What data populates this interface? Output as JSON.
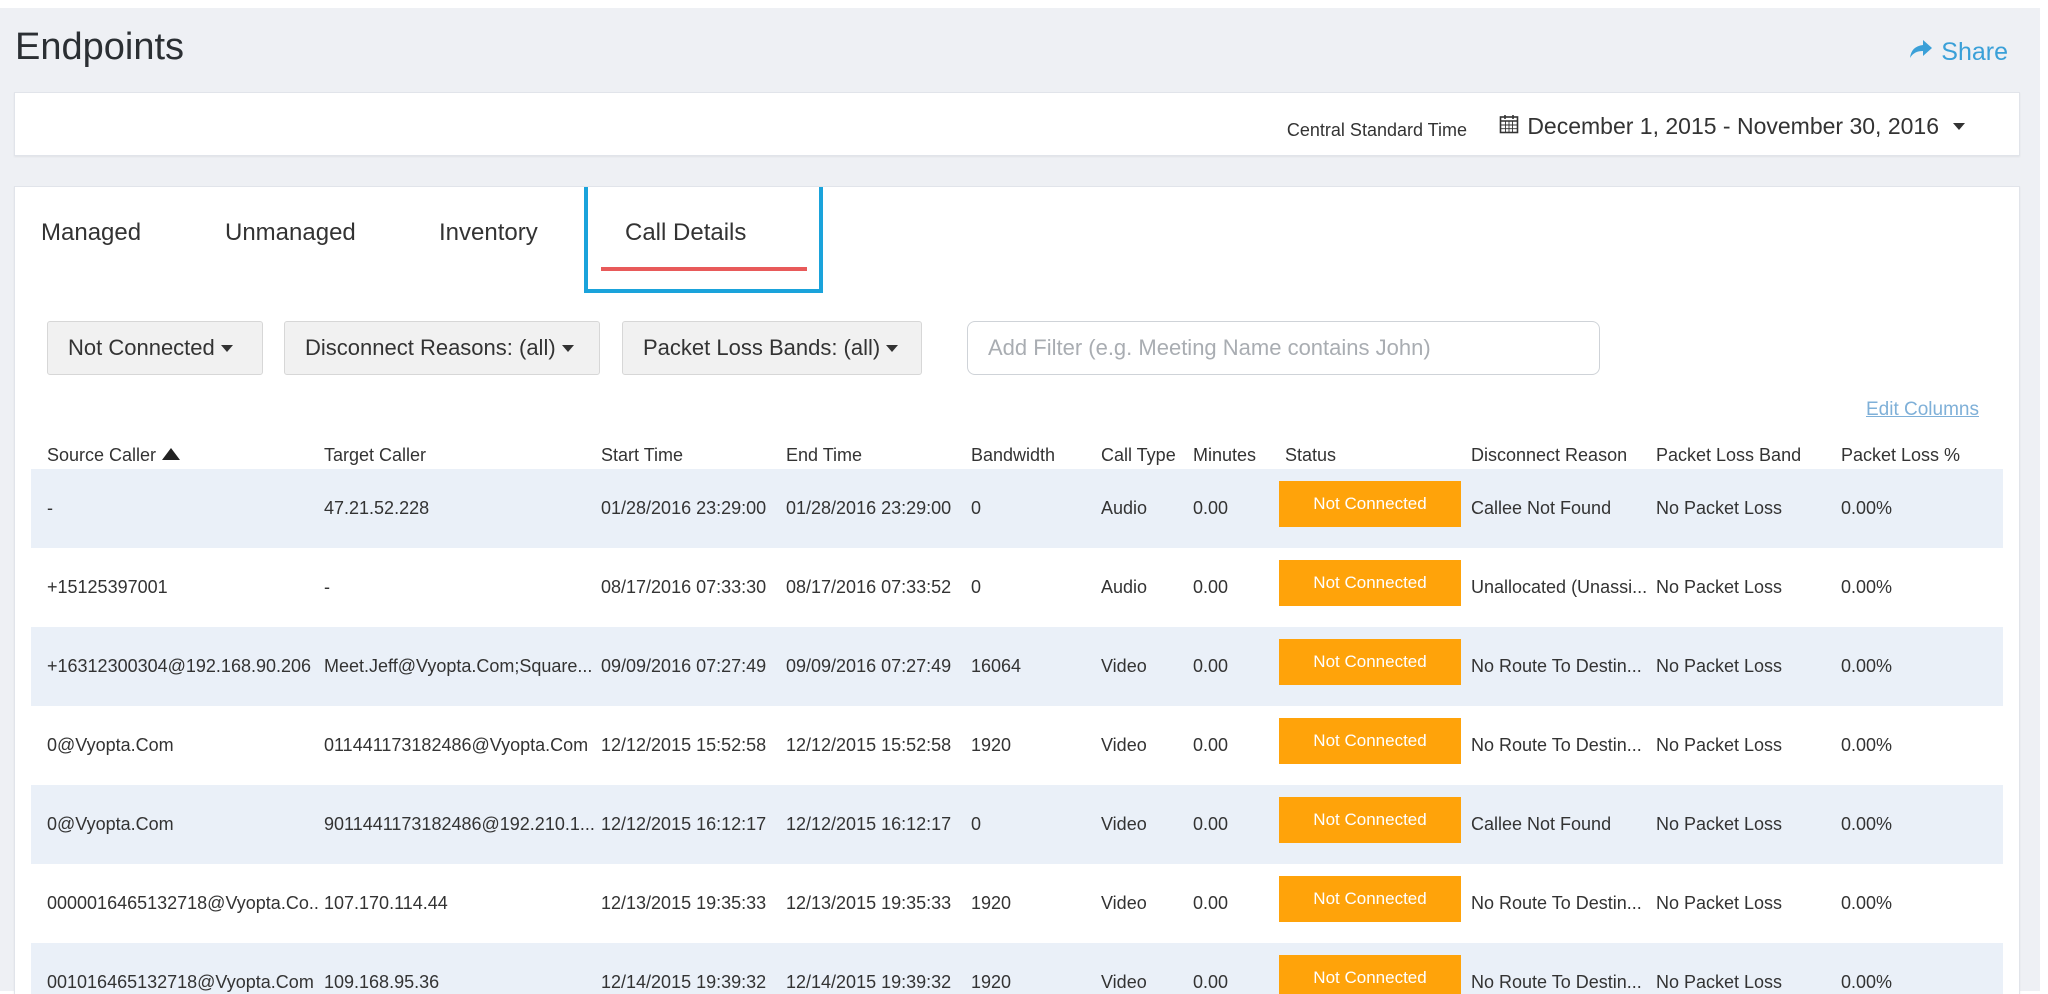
{
  "page": {
    "title": "Endpoints",
    "share_label": "Share"
  },
  "timebar": {
    "timezone": "Central Standard Time",
    "date_range": "December 1, 2015 - November 30, 2016"
  },
  "tabs": [
    {
      "label": "Managed"
    },
    {
      "label": "Unmanaged"
    },
    {
      "label": "Inventory"
    },
    {
      "label": "Call Details",
      "active": true
    }
  ],
  "filters": {
    "status": "Not Connected",
    "disconnect_reasons": "Disconnect Reasons: (all)",
    "packet_loss_bands": "Packet Loss Bands: (all)",
    "add_filter_placeholder": "Add Filter (e.g. Meeting Name contains John)"
  },
  "edit_columns_label": "Edit Columns",
  "columns": [
    "Source Caller",
    "Target Caller",
    "Start Time",
    "End Time",
    "Bandwidth",
    "Call Type",
    "Minutes",
    "Status",
    "Disconnect Reason",
    "Packet Loss Band",
    "Packet Loss %"
  ],
  "rows": [
    [
      "-",
      "47.21.52.228",
      "01/28/2016 23:29:00",
      "01/28/2016 23:29:00",
      "0",
      "Audio",
      "0.00",
      "Not Connected",
      "Callee Not Found",
      "No Packet Loss",
      "0.00%"
    ],
    [
      "+15125397001",
      "-",
      "08/17/2016 07:33:30",
      "08/17/2016 07:33:52",
      "0",
      "Audio",
      "0.00",
      "Not Connected",
      "Unallocated (Unassi...",
      "No Packet Loss",
      "0.00%"
    ],
    [
      "+16312300304@192.168.90.206",
      "Meet.Jeff@Vyopta.Com;Square...",
      "09/09/2016 07:27:49",
      "09/09/2016 07:27:49",
      "16064",
      "Video",
      "0.00",
      "Not Connected",
      "No Route To Destin...",
      "No Packet Loss",
      "0.00%"
    ],
    [
      "0@Vyopta.Com",
      "011441173182486@Vyopta.Com",
      "12/12/2015 15:52:58",
      "12/12/2015 15:52:58",
      "1920",
      "Video",
      "0.00",
      "Not Connected",
      "No Route To Destin...",
      "No Packet Loss",
      "0.00%"
    ],
    [
      "0@Vyopta.Com",
      "9011441173182486@192.210.1...",
      "12/12/2015 16:12:17",
      "12/12/2015 16:12:17",
      "0",
      "Video",
      "0.00",
      "Not Connected",
      "Callee Not Found",
      "No Packet Loss",
      "0.00%"
    ],
    [
      "0000016465132718@Vyopta.Co...",
      "107.170.114.44",
      "12/13/2015 19:35:33",
      "12/13/2015 19:35:33",
      "1920",
      "Video",
      "0.00",
      "Not Connected",
      "No Route To Destin...",
      "No Packet Loss",
      "0.00%"
    ],
    [
      "001016465132718@Vyopta.Com",
      "109.168.95.36",
      "12/14/2015 19:39:32",
      "12/14/2015 19:39:32",
      "1920",
      "Video",
      "0.00",
      "Not Connected",
      "No Route To Destin...",
      "No Packet Loss",
      "0.00%"
    ]
  ],
  "colors": {
    "accent": "#3aa0d8",
    "status_badge": "#ffa30a",
    "tab_underline": "#e85a5a",
    "highlight_box": "#1aa3db",
    "row_alt": "#eaf0f8"
  },
  "icons": {
    "share": "share-arrow-icon",
    "calendar": "calendar-icon",
    "sort": "sort-ascending-icon",
    "dropdown": "caret-down-icon"
  }
}
